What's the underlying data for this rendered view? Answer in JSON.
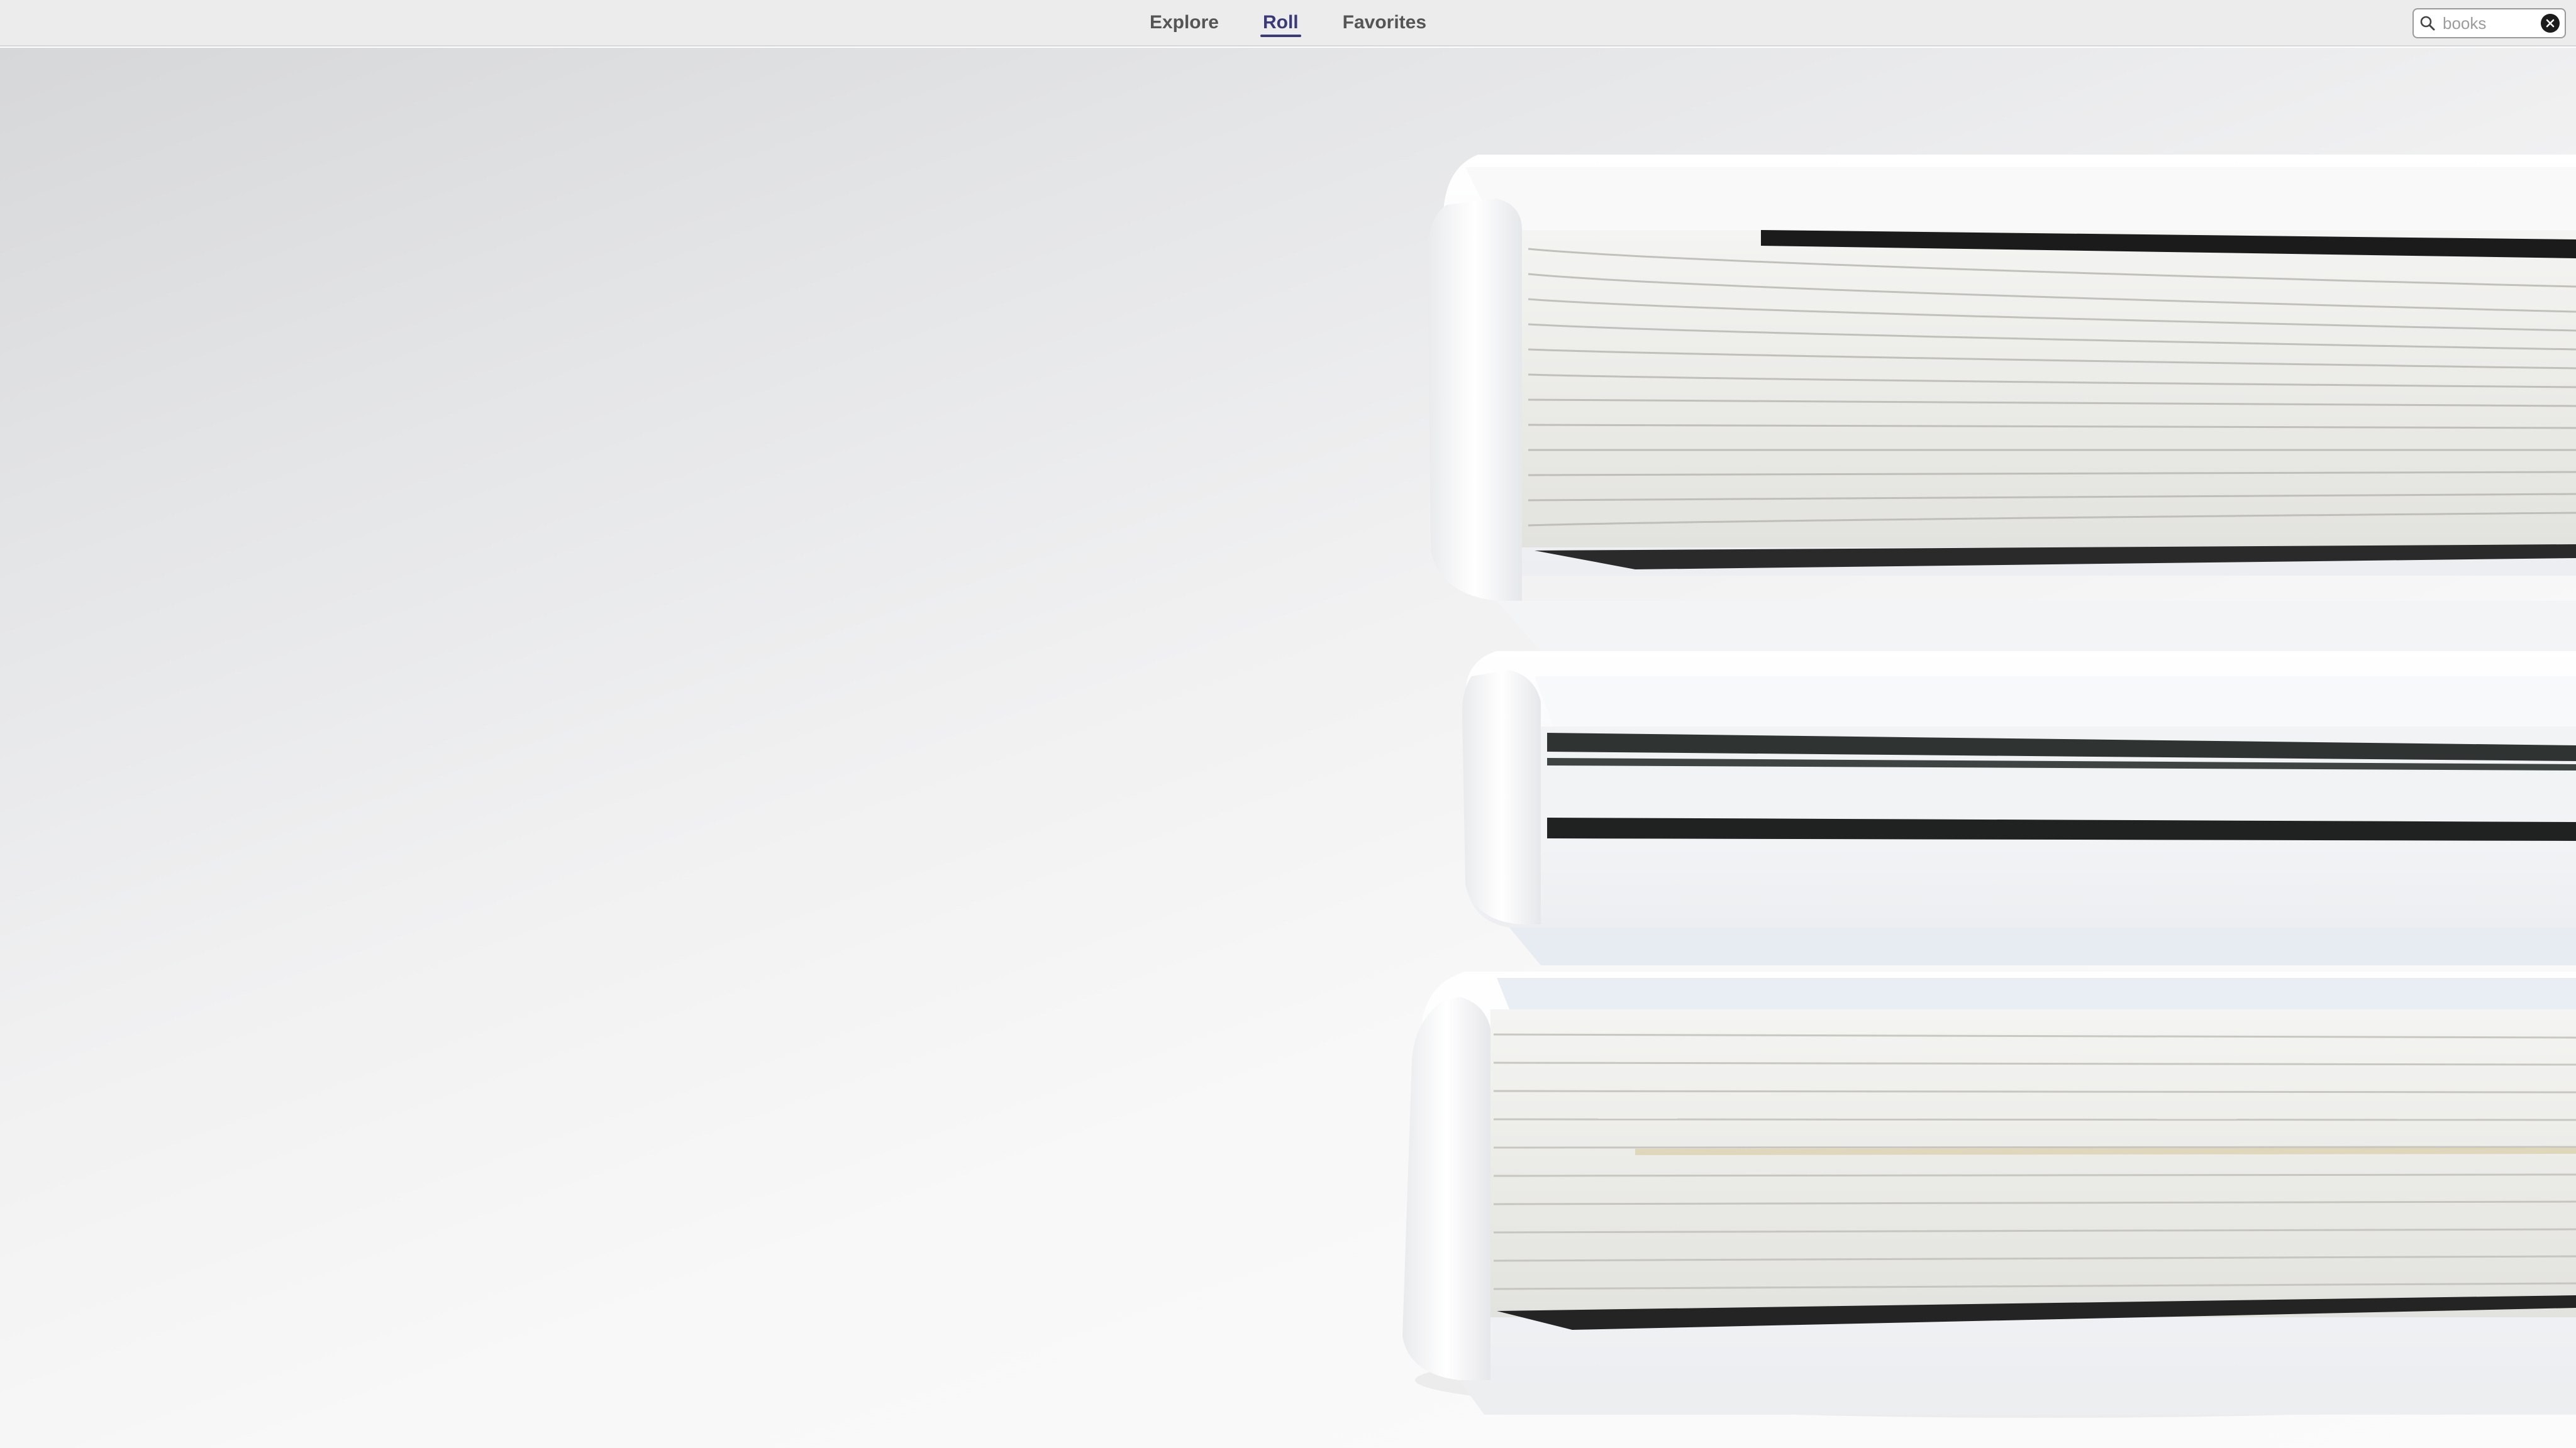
{
  "nav": {
    "tabs": [
      {
        "label": "Explore",
        "active": false
      },
      {
        "label": "Roll",
        "active": true
      },
      {
        "label": "Favorites",
        "active": false
      }
    ],
    "accent_color": "#3a3a78"
  },
  "search": {
    "value": "",
    "placeholder": "books",
    "icon": "search-icon",
    "clear_icon": "clear-icon"
  },
  "photo": {
    "subject": "stack-of-white-books"
  }
}
